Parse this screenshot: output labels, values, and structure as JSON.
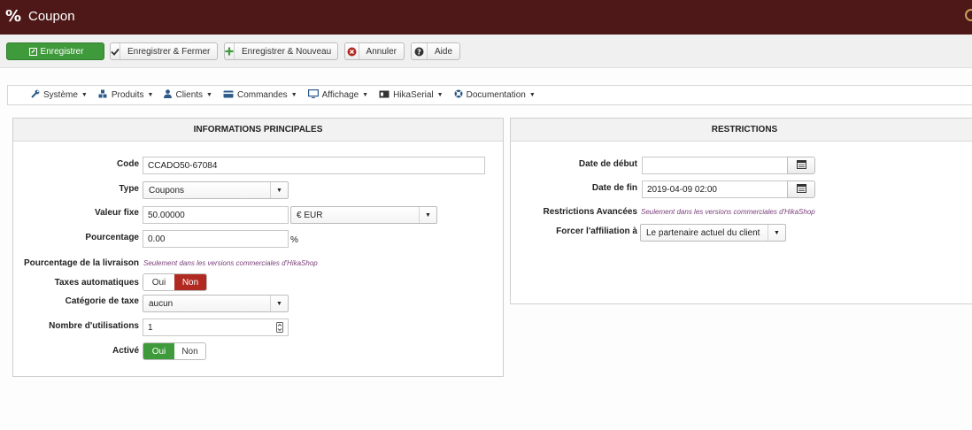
{
  "header": {
    "title": "Coupon"
  },
  "toolbar": {
    "save": "Enregistrer",
    "save_close": "Enregistrer & Fermer",
    "save_new": "Enregistrer & Nouveau",
    "cancel": "Annuler",
    "help": "Aide"
  },
  "nav": {
    "items": [
      {
        "label": "Système",
        "icon": "wrench-icon"
      },
      {
        "label": "Produits",
        "icon": "cubes-icon"
      },
      {
        "label": "Clients",
        "icon": "user-icon"
      },
      {
        "label": "Commandes",
        "icon": "credit-card-icon"
      },
      {
        "label": "Affichage",
        "icon": "monitor-icon"
      },
      {
        "label": "HikaSerial",
        "icon": "serial-icon"
      },
      {
        "label": "Documentation",
        "icon": "lifebuoy-icon"
      }
    ]
  },
  "main": {
    "title": "INFORMATIONS PRINCIPALES",
    "code_label": "Code",
    "code_value": "CCADO50-67084",
    "type_label": "Type",
    "type_value": "Coupons",
    "value_label": "Valeur fixe",
    "value_value": "50.00000",
    "currency_value": "€ EUR",
    "percent_label": "Pourcentage",
    "percent_value": "0.00",
    "percent_unit": "%",
    "shipping_percent_label": "Pourcentage de la livraison",
    "commercial_note": "Seulement dans les versions commerciales d'HikaShop",
    "auto_tax_label": "Taxes automatiques",
    "yes": "Oui",
    "no": "Non",
    "tax_cat_label": "Catégorie de taxe",
    "tax_cat_value": "aucun",
    "uses_label": "Nombre d'utilisations",
    "uses_value": "1",
    "active_label": "Activé"
  },
  "restrictions": {
    "title": "RESTRICTIONS",
    "start_label": "Date de début",
    "start_value": "",
    "end_label": "Date de fin",
    "end_value": "2019-04-09 02:00",
    "advanced_label": "Restrictions Avancées",
    "advanced_note": "Seulement dans les versions commerciales d'HikaShop",
    "affiliate_label": "Forcer l'affiliation à",
    "affiliate_value": "Le partenaire actuel du client"
  },
  "colors": {
    "header_bg": "#4f1818",
    "success": "#3f9a3b",
    "danger": "#b12a22"
  }
}
